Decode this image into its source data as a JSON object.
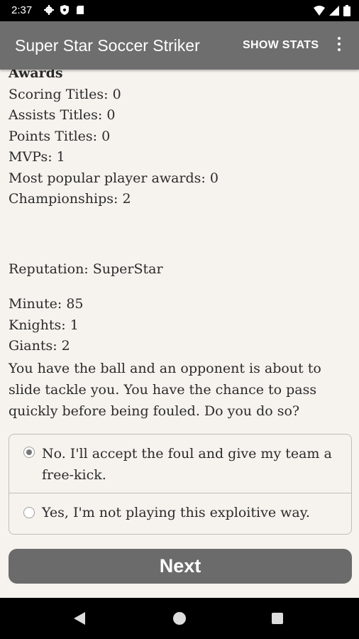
{
  "status": {
    "time": "2:37",
    "icons_left": [
      "gear-icon",
      "shield-icon",
      "sd-card-icon"
    ],
    "icons_right": [
      "wifi-icon",
      "signal-icon",
      "battery-icon"
    ]
  },
  "app_bar": {
    "title": "Super Star Soccer Striker",
    "show_stats": "SHOW STATS",
    "overflow_icon": "more-vert-icon"
  },
  "awards": {
    "heading": "Awards",
    "items": [
      "Scoring Titles: 0",
      "Assists Titles: 0",
      "Points Titles: 0",
      "MVPs: 1",
      "Most popular player awards: 0",
      "Championships: 2"
    ]
  },
  "reputation": "Reputation: SuperStar",
  "match": {
    "minute": "Minute: 85",
    "team1": "Knights: 1",
    "team2": "Giants: 2"
  },
  "question": "You have the ball and an opponent is about to slide tackle you. You have the chance to pass quickly before being fouled. Do you do so?",
  "choices": [
    {
      "label": "No. I'll accept the foul and give my team a free-kick.",
      "selected": true
    },
    {
      "label": "Yes, I'm not playing this exploitive way.",
      "selected": false
    }
  ],
  "next_button": "Next",
  "nav": [
    "back-icon",
    "home-icon",
    "recents-icon"
  ]
}
